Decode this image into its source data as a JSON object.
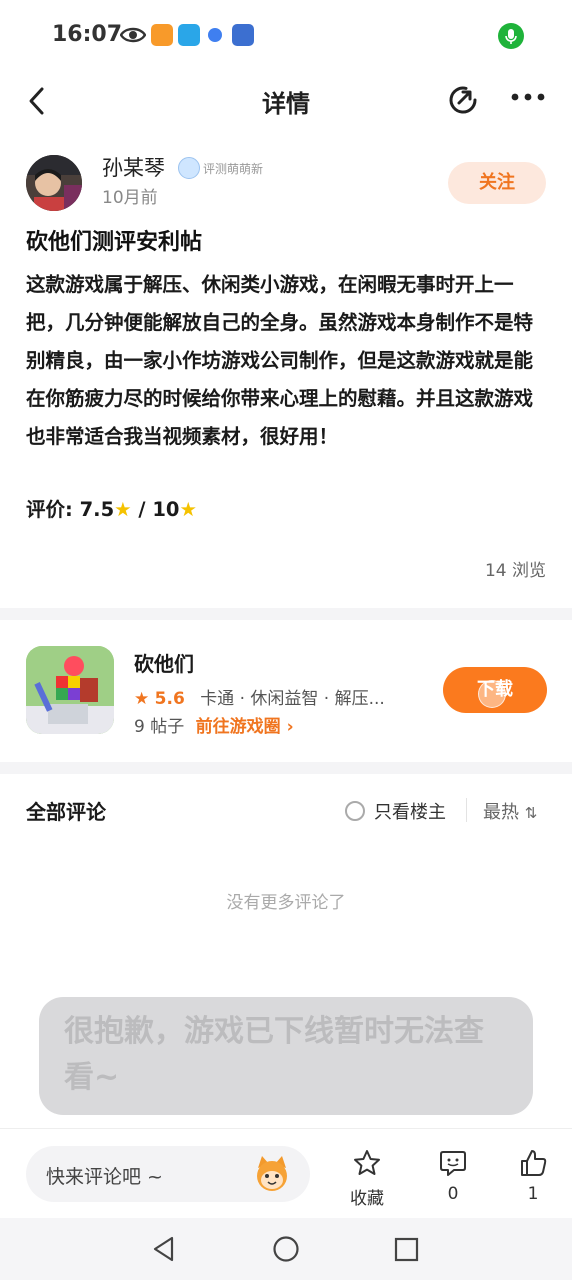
{
  "status_bar": {
    "time": "16:07"
  },
  "header": {
    "title": "详情"
  },
  "post": {
    "author": "孙某琴",
    "author_badge": "评测萌萌新",
    "time_ago": "10月前",
    "follow_label": "关注",
    "title": "砍他们测评安利帖",
    "body": "这款游戏属于解压、休闲类小游戏，在闲暇无事时开上一把，几分钟便能解放自己的全身。虽然游戏本身制作不是特别精良，由一家小作坊游戏公司制作，但是这款游戏就是能在你筋疲力尽的时候给你带来心理上的慰藉。并且这款游戏也非常适合我当视频素材，很好用！",
    "rating_label": "评价: ",
    "rating_score": "7.5",
    "rating_sep": " / ",
    "rating_max": "10",
    "views": "14 浏览"
  },
  "game": {
    "name": "砍他们",
    "score": "5.6",
    "tags": "卡通 · 休闲益智 · 解压...",
    "posts": "9 帖子",
    "goto_label": "前往游戏圈",
    "download_label": "下载"
  },
  "comments": {
    "title": "全部评论",
    "only_owner": "只看楼主",
    "sort": "最热",
    "empty": "没有更多评论了"
  },
  "toast": {
    "text": "很抱歉，游戏已下线暂时无法查看~"
  },
  "bottom_bar": {
    "comment_placeholder": "快来评论吧 ~",
    "favorite_label": "收藏",
    "comment_count": "0",
    "like_count": "1"
  },
  "colors": {
    "accent": "#f07520",
    "download_bg": "#fb7a1e",
    "follow_bg": "#fde8dd",
    "star": "#f5c200"
  }
}
